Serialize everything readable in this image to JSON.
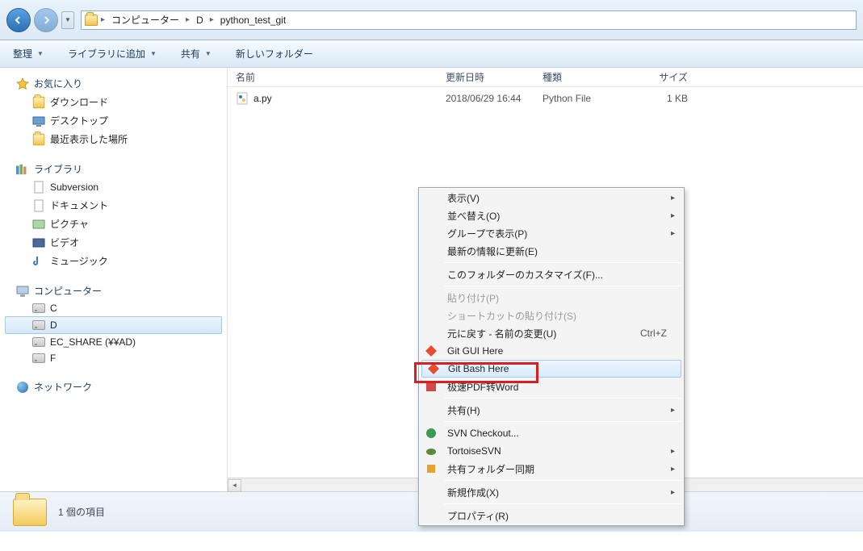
{
  "breadcrumb": {
    "root": "コンピューター",
    "drive": "D",
    "folder": "python_test_git"
  },
  "toolbar": {
    "organize": "整理",
    "addlib": "ライブラリに追加",
    "share": "共有",
    "newfolder": "新しいフォルダー"
  },
  "sidebar": {
    "favorites": {
      "label": "お気に入り",
      "items": [
        "ダウンロード",
        "デスクトップ",
        "最近表示した場所"
      ]
    },
    "libraries": {
      "label": "ライブラリ",
      "items": [
        "Subversion",
        "ドキュメント",
        "ピクチャ",
        "ビデオ",
        "ミュージック"
      ]
    },
    "computer": {
      "label": "コンピューター",
      "items": [
        "C",
        "D",
        "EC_SHARE (¥¥AD)",
        "F"
      ]
    },
    "network": {
      "label": "ネットワーク"
    }
  },
  "columns": {
    "name": "名前",
    "date": "更新日時",
    "type": "種類",
    "size": "サイズ"
  },
  "files": [
    {
      "name": "a.py",
      "date": "2018/06/29 16:44",
      "type": "Python File",
      "size": "1 KB"
    }
  ],
  "context": {
    "view": "表示(V)",
    "sort": "並べ替え(O)",
    "group": "グループで表示(P)",
    "refresh": "最新の情報に更新(E)",
    "customize": "このフォルダーのカスタマイズ(F)...",
    "paste": "貼り付け(P)",
    "paste_shortcut": "ショートカットの貼り付け(S)",
    "undo": "元に戻す - 名前の変更(U)",
    "undo_key": "Ctrl+Z",
    "git_gui": "Git GUI Here",
    "git_bash": "Git Bash Here",
    "pdf": "极速PDF转Word",
    "share": "共有(H)",
    "svn_checkout": "SVN Checkout...",
    "tortoise": "TortoiseSVN",
    "sync": "共有フォルダー同期",
    "new": "新規作成(X)",
    "properties": "プロパティ(R)"
  },
  "status": {
    "text": "1 個の項目"
  }
}
